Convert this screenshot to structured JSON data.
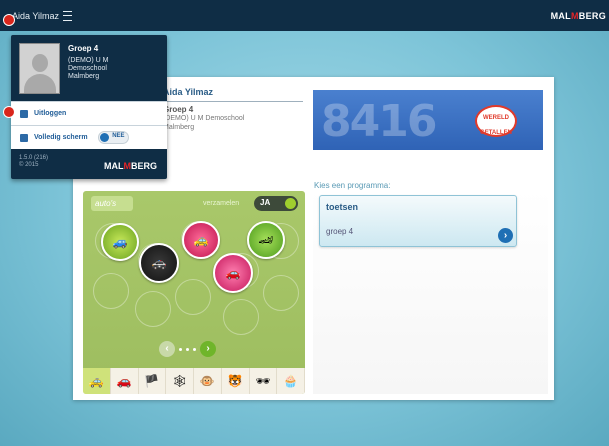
{
  "topbar": {
    "user_label": "Aida Yilmaz",
    "brand_left": "MAL",
    "brand_mid": "M",
    "brand_right": "BERG"
  },
  "menu": {
    "group": "Groep 4",
    "school": "(DEMO) U M\nDemoschool\nMalmberg",
    "logout_label": "Uitloggen",
    "fullscreen_label": "Volledig scherm",
    "fullscreen_toggle": "NEE",
    "version": "1.5.0 (216)\n© 2015",
    "logo_left": "MAL",
    "logo_mid": "M",
    "logo_right": "BERG"
  },
  "profile": {
    "name": "Aida Yilmaz",
    "group": "Groep 4",
    "school": "(DEMO) U M Demoschool\nMalmberg"
  },
  "banner": {
    "numbers": "8416",
    "logo_line1": "WERELD",
    "logo_line2": "GETALLEN"
  },
  "programs": {
    "heading": "Kies een programma:",
    "items": [
      {
        "title": "toetsen",
        "subtitle": "groep 4"
      }
    ]
  },
  "collection": {
    "tag": "auto's",
    "collect_label": "verzamelen",
    "collect_value": "JA",
    "pager_prev": "‹",
    "pager_next": "›",
    "categories": [
      "🚕",
      "🚗",
      "🏴",
      "🕸",
      "🐵",
      "🐯",
      "🕶",
      "🧁"
    ]
  },
  "colors": {
    "topbar": "#0f2d45",
    "accent": "#1f6fb4",
    "marker": "#d9261c",
    "game_bg": "#a9c86a"
  }
}
